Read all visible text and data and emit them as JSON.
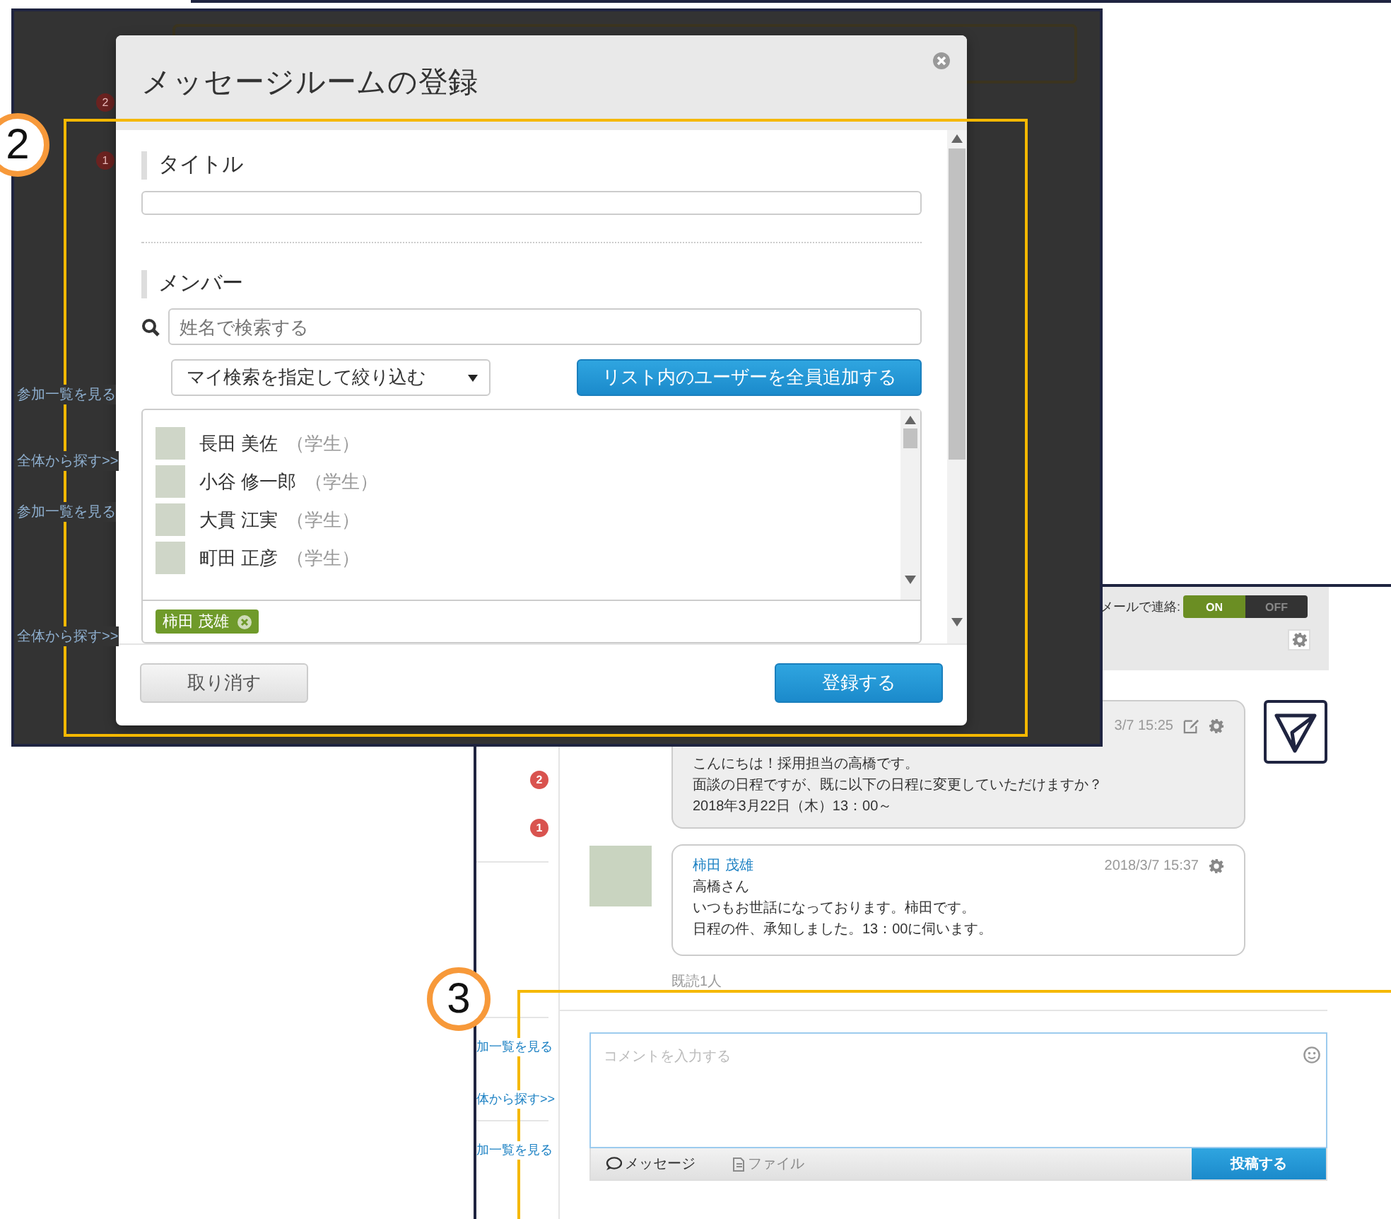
{
  "background_window": {
    "badges": [
      "2",
      "1"
    ],
    "links": [
      {
        "text": "参加一覧を見る"
      },
      {
        "text": "全体から探す>>"
      },
      {
        "text": "参加一覧を見る"
      },
      {
        "text": "全体から探す>>"
      }
    ]
  },
  "dialog": {
    "title": "メッセージルームの登録",
    "title_field": {
      "label": "タイトル"
    },
    "members": {
      "label": "メンバー",
      "search": {
        "placeholder": "姓名で検索する"
      },
      "filter": "マイ検索を指定して絞り込む",
      "add_all_button": "リスト内のユーザーを全員追加する",
      "users": [
        {
          "name": "長田 美佐",
          "role": "（学生）"
        },
        {
          "name": "小谷 修一郎",
          "role": "（学生）"
        },
        {
          "name": "大貫 江実",
          "role": "（学生）"
        },
        {
          "name": "町田 正彦",
          "role": "（学生）"
        }
      ],
      "selected": [
        {
          "name": "柿田 茂雄"
        }
      ]
    },
    "cancel_button": "取り消す",
    "submit_button": "登録する"
  },
  "chat_window": {
    "sidebar_badges": [
      "2",
      "1"
    ],
    "sidebar_links": [
      {
        "text": "加一覧を見る"
      },
      {
        "text": "体から探す>>"
      },
      {
        "text": "加一覧を見る"
      }
    ],
    "email_notice": {
      "label": "メールで連絡:",
      "options": [
        {
          "label": "ON",
          "selected": true
        },
        {
          "label": "OFF",
          "selected": false
        }
      ]
    },
    "messages": [
      {
        "kind": "own",
        "time": "3/7 15:25",
        "lines": [
          "こんにちは！採用担当の高橋です。",
          "面談の日程ですが、既に以下の日程に変更していただけますか？",
          "2018年3月22日（木）13：00～"
        ]
      },
      {
        "kind": "other",
        "sender": "柿田 茂雄",
        "time": "2018/3/7 15:37",
        "lines": [
          "高橋さん",
          "いつもお世話になっております。柿田です。",
          "日程の件、承知しました。13：00に伺います。"
        ]
      }
    ],
    "read_status": "既読1人",
    "composer": {
      "placeholder": "コメントを入力する",
      "tabs": [
        {
          "label": "メッセージ",
          "selected": true
        },
        {
          "label": "ファイル",
          "selected": false
        }
      ],
      "post_button": "投稿する"
    }
  },
  "callouts": [
    {
      "number": "2"
    },
    {
      "number": "3"
    }
  ]
}
